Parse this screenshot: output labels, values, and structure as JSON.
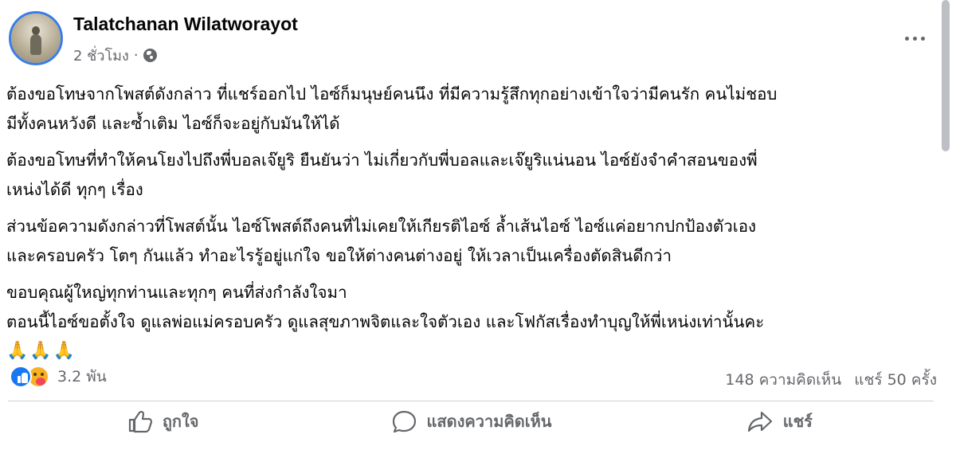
{
  "post": {
    "author": "Talatchanan Wilatworayot",
    "time": "2 ชั่วโมง",
    "separator": "·",
    "privacy_icon": "globe-icon",
    "paragraphs": [
      [
        "ต้องขอโทษจากโพสต์ดังกล่าว ที่แชร์ออกไป ไอซ์ก็มนุษย์คนนึง ที่มีความรู้สึกทุกอย่างเข้าใจว่ามีคนรัก คนไม่ชอบ",
        "มีทั้งคนหวังดี และซ้ำเติม ไอซ์ก็จะอยู่กับมันให้ได้"
      ],
      [
        "ต้องขอโทษที่ทำให้คนโยงไปถึงพี่บอลเจ๊ยูริ ยืนยันว่า ไม่เกี่ยวกับพี่บอลและเจ๊ยูริแน่นอน ไอซ์ยังจำคำสอนของพี่",
        "เหน่งได้ดี ทุกๆ เรื่อง"
      ],
      [
        "ส่วนข้อความดังกล่าวที่โพสต์นั้น ไอซ์โพสต์ถึงคนที่ไม่เคยให้เกียรติไอซ์ ล้ำเส้นไอซ์ ไอซ์แค่อยากปกป้องตัวเอง",
        "และครอบครัว โตๆ กันแล้ว ทำอะไรรู้อยู่แก่ใจ ขอให้ต่างคนต่างอยู่ ให้เวลาเป็นเครื่องตัดสินดีกว่า"
      ],
      [
        "ขอบคุณผู้ใหญ่ทุกท่านและทุกๆ คนที่ส่งกำลังใจมา",
        "ตอนนี้ไอซ์ขอตั้งใจ ดูแลพ่อแม่ครอบครัว ดูแลสุขภาพจิตและใจตัวเอง และโฟกัสเรื่องทำบุญให้พี่เหน่งเท่านั้นคะ"
      ]
    ],
    "emoji_line": "🙏🙏🙏"
  },
  "reactions": {
    "icons": [
      "like-icon",
      "care-icon"
    ],
    "count": "3.2 พัน"
  },
  "stats": {
    "comments": "148 ความคิดเห็น",
    "shares": "แชร์ 50 ครั้ง"
  },
  "actions": {
    "like_label": "ถูกใจ",
    "comment_label": "แสดงความคิดเห็น",
    "share_label": "แชร์"
  },
  "colors": {
    "accent": "#1877f2",
    "secondary_text": "#65676b",
    "divider": "#ced0d4"
  }
}
